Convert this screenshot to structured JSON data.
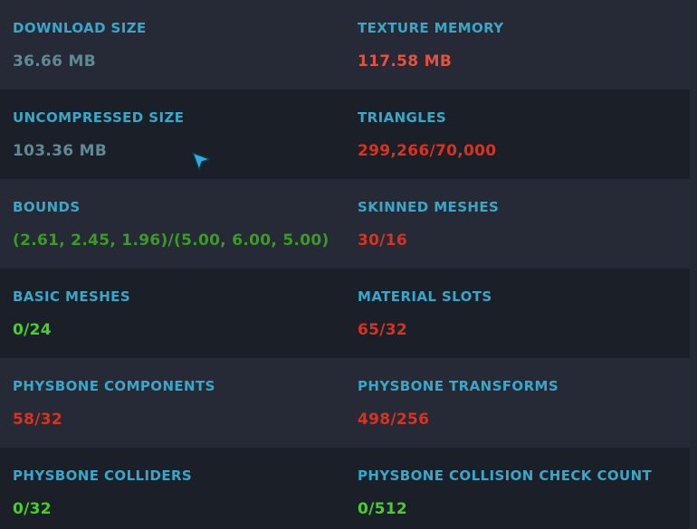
{
  "colors": {
    "label": "#3aa7c9",
    "neutral": "#5f8a93",
    "over_limit_orange": "#e2533f",
    "over_limit_red": "#d9321f",
    "bounds_green": "#3c9a25",
    "ok_green": "#45d12a",
    "row_alt": "#252a36",
    "row_base": "#1b1f28"
  },
  "stats": {
    "download_size": {
      "label": "DOWNLOAD SIZE",
      "value": "36.66 MB"
    },
    "texture_memory": {
      "label": "TEXTURE MEMORY",
      "value": "117.58 MB"
    },
    "uncompressed_size": {
      "label": "UNCOMPRESSED SIZE",
      "value": "103.36 MB"
    },
    "triangles": {
      "label": "TRIANGLES",
      "value": "299,266/70,000"
    },
    "bounds": {
      "label": "BOUNDS",
      "value": "(2.61, 2.45, 1.96)/(5.00, 6.00, 5.00)"
    },
    "skinned_meshes": {
      "label": "SKINNED MESHES",
      "value": "30/16"
    },
    "basic_meshes": {
      "label": "BASIC MESHES",
      "value": "0/24"
    },
    "material_slots": {
      "label": "MATERIAL SLOTS",
      "value": "65/32"
    },
    "physbone_components": {
      "label": "PHYSBONE COMPONENTS",
      "value": "58/32"
    },
    "physbone_transforms": {
      "label": "PHYSBONE TRANSFORMS",
      "value": "498/256"
    },
    "physbone_colliders": {
      "label": "PHYSBONE COLLIDERS",
      "value": "0/32"
    },
    "physbone_collision_check_count": {
      "label": "PHYSBONE COLLISION CHECK COUNT",
      "value": "0/512"
    }
  },
  "cursor": {
    "icon": "pointer-cursor-icon"
  }
}
